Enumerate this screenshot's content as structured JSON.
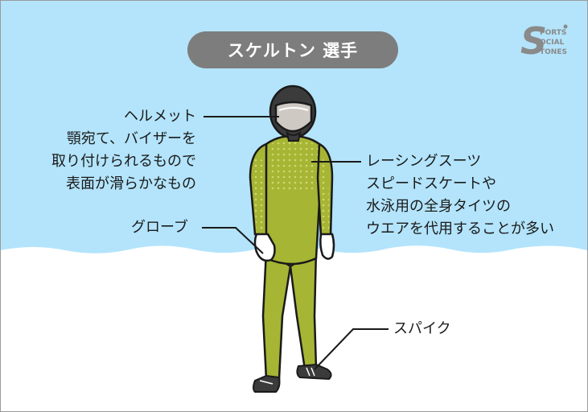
{
  "title": "スケルトン 選手",
  "logo_text": "SPORTS SOCIAL STONES",
  "labels": {
    "helmet": [
      "ヘルメット",
      "顎宛て、バイザーを",
      "取り付けられるもので",
      "表面が滑らかなもの"
    ],
    "suit": [
      "レーシングスーツ",
      "スピードスケートや",
      "水泳用の全身タイツの",
      "ウエアを代用することが多い"
    ],
    "glove": [
      "グローブ"
    ],
    "spike": [
      "スパイク"
    ]
  },
  "colors": {
    "sky": "#b3e4fb",
    "snow": "#ffffff",
    "suit": "#a6b534",
    "suit_dots": "#c8d46a",
    "helmet": "#3b3b3b",
    "visor": "#cfc9c4",
    "pill": "#7d7d7d"
  }
}
